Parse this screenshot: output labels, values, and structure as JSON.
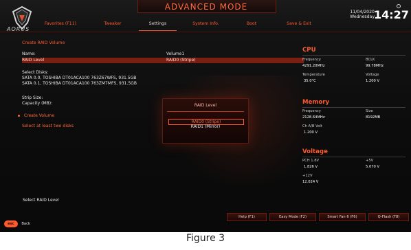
{
  "header": {
    "title": "ADVANCED MODE",
    "brand_text": "AORUS",
    "date": "11/04/2020",
    "day": "Wednesday",
    "time": "14:27"
  },
  "nav": {
    "tabs": [
      {
        "label": "Favorites (F11)"
      },
      {
        "label": "Tweaker"
      },
      {
        "label": "Settings"
      },
      {
        "label": "System Info."
      },
      {
        "label": "Boot"
      },
      {
        "label": "Save & Exit"
      }
    ],
    "active_index": 2
  },
  "main": {
    "page_title": "Create RAID Volume",
    "name_label": "Name:",
    "name_value": "Volume1",
    "raid_level_label": "RAID Level",
    "raid_level_value": "RAID0 (Stripe)",
    "select_disks_label": "Select Disks:",
    "disk1": "SATA 0.0, TOSHIBA DT01ACA100 763Z67WFS, 931.5GB",
    "disk2": "SATA 0.1, TOSHIBA DT01ACA100 763ZM7MFS, 931.5GB",
    "strip_size_label": "Strip Size:",
    "capacity_label": "Capacity (MB):",
    "create_volume_label": "Create Volume",
    "warning": "Select at least two disks",
    "help_text": "Select RAID Level"
  },
  "dialog": {
    "title": "RAID Level",
    "options": [
      {
        "label": "RAID0 (Stripe)"
      },
      {
        "label": "RAID1 (Mirror)"
      }
    ],
    "selected_index": 0
  },
  "right_panel": {
    "cpu": {
      "title": "CPU",
      "frequency_label": "Frequency",
      "frequency_value": "4291.20MHz",
      "bclk_label": "BCLK",
      "bclk_value": "99.78MHz",
      "temp_label": "Temperature",
      "temp_value": "35.0°C",
      "voltage_label": "Voltage",
      "voltage_value": "1.200 V"
    },
    "memory": {
      "title": "Memory",
      "frequency_label": "Frequency",
      "frequency_value": "2128.64MHz",
      "size_label": "Size",
      "size_value": "8192MB",
      "volt_label": "Ch A/B Volt",
      "volt_value": "1.200 V"
    },
    "voltage": {
      "title": "Voltage",
      "pch_label": "PCH 1.8V",
      "pch_value": "1.826 V",
      "p5v_label": "+5V",
      "p5v_value": "5.070 V",
      "p12v_label": "+12V",
      "p12v_value": "12.024 V"
    }
  },
  "bottom_bar": {
    "esc_label": "esc",
    "back_label": "Back",
    "buttons": [
      {
        "label": "Help (F1)"
      },
      {
        "label": "Easy Mode (F2)"
      },
      {
        "label": "Smart Fan 6 (F6)"
      },
      {
        "label": "Q-Flash (F8)"
      }
    ]
  },
  "caption": "Figure 3",
  "colors": {
    "accent": "#ff5a2e",
    "highlight": "#7b1f13",
    "background": "#0c0c0c"
  }
}
